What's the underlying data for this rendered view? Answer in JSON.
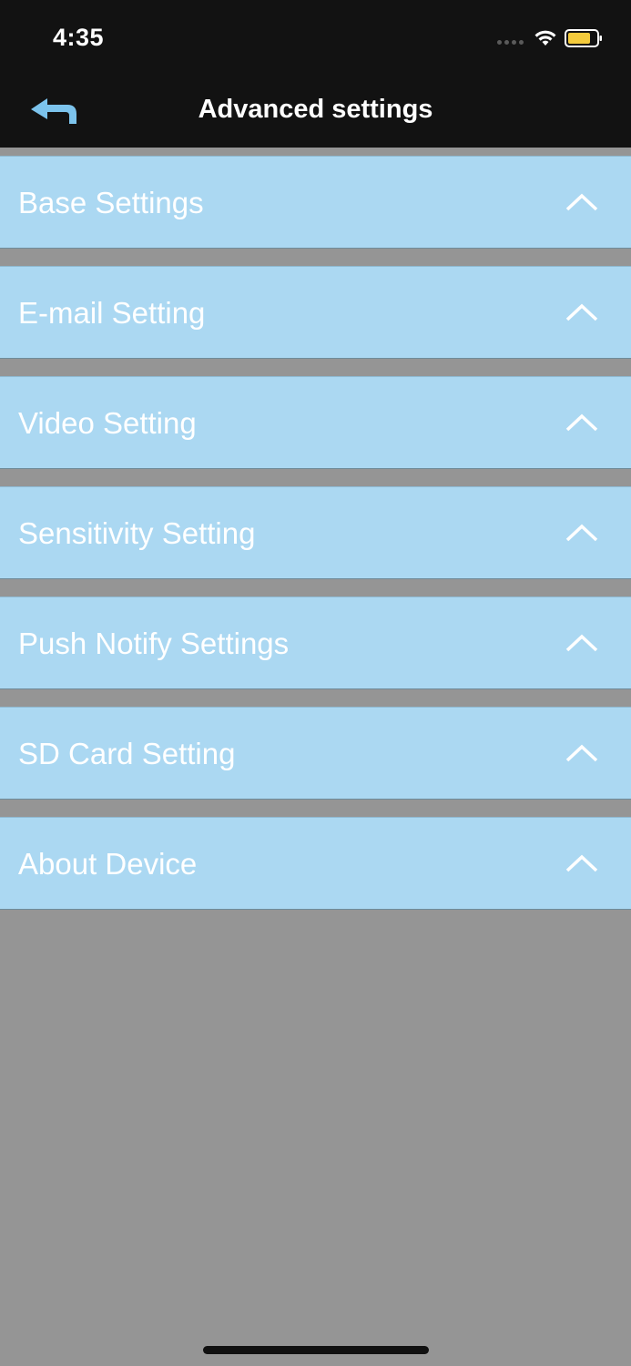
{
  "status_bar": {
    "time": "4:35",
    "battery_color": "#f4cb3c"
  },
  "nav": {
    "title": "Advanced settings",
    "back_icon_color": "#7cc3ec"
  },
  "sections": [
    {
      "label": "Base Settings",
      "expanded": false
    },
    {
      "label": "E-mail Setting",
      "expanded": false
    },
    {
      "label": "Video Setting",
      "expanded": false
    },
    {
      "label": "Sensitivity Setting",
      "expanded": false
    },
    {
      "label": "Push Notify Settings",
      "expanded": false
    },
    {
      "label": "SD Card Setting",
      "expanded": false
    },
    {
      "label": "About Device",
      "expanded": false
    }
  ],
  "colors": {
    "section_bg": "#abd8f2",
    "page_bg": "#959595",
    "bar_bg": "#121212"
  }
}
